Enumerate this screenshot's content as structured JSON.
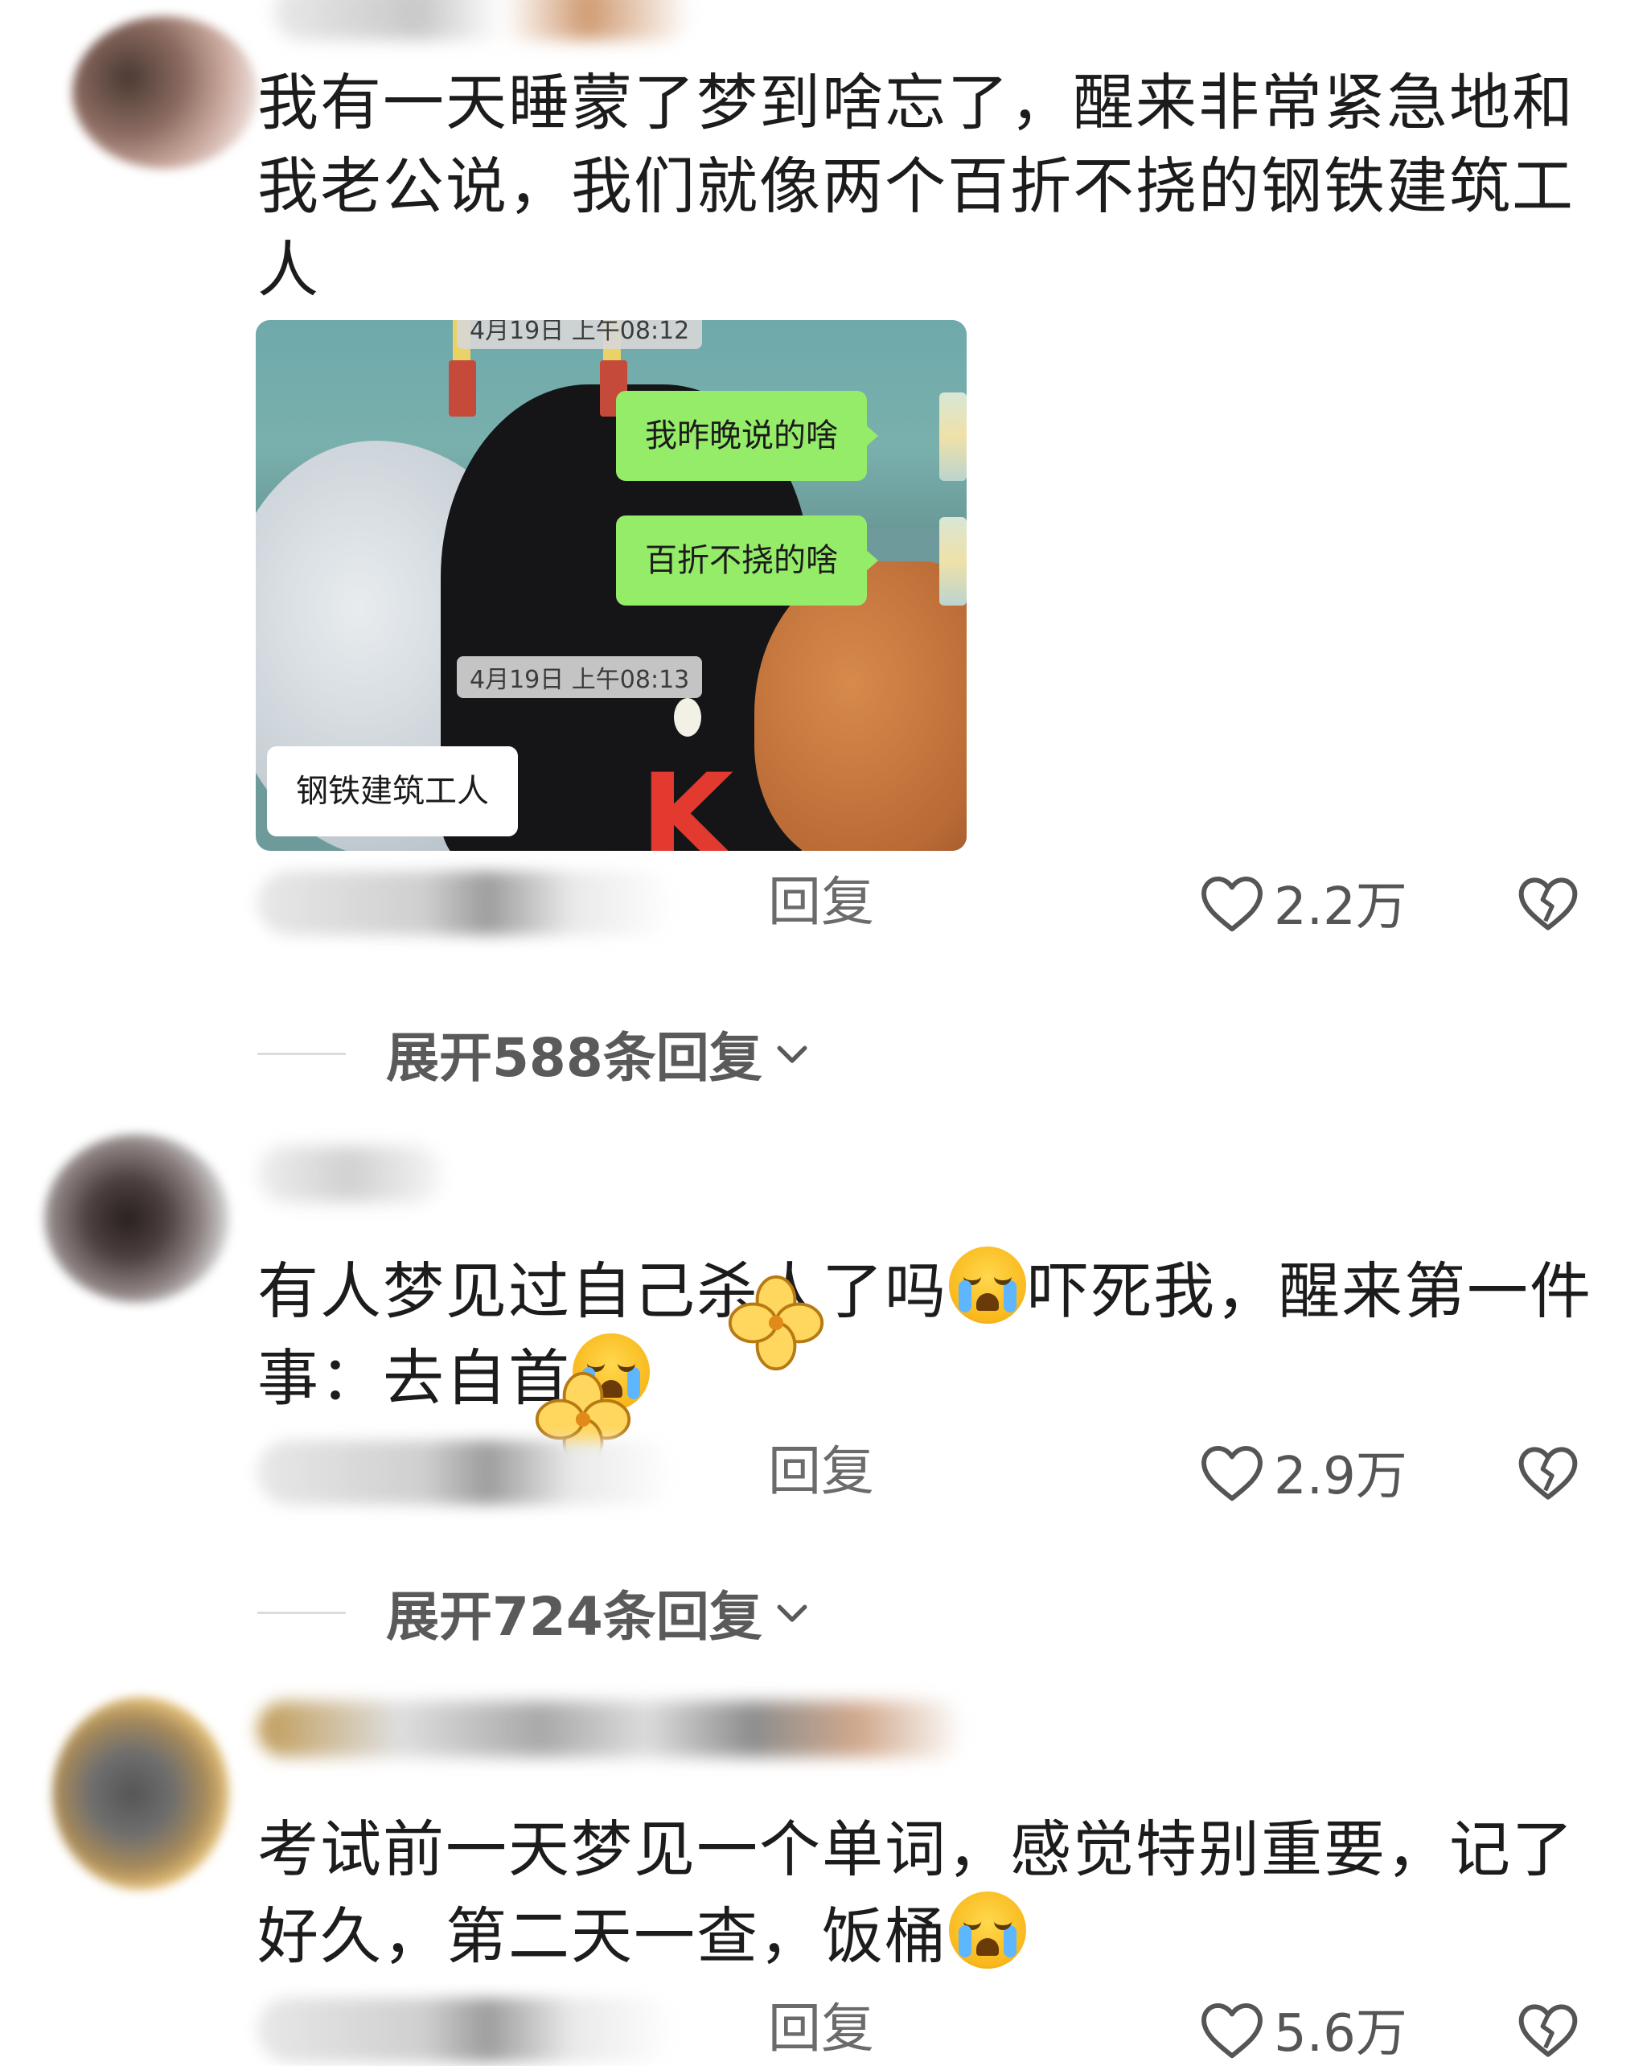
{
  "comments": [
    {
      "text": "我有一天睡蒙了梦到啥忘了，醒来非常紧急地和我老公说，我们就像两个百折不挠的钢铁建筑工人",
      "reply_label": "回复",
      "likes": "2.2万",
      "expand_label": "展开588条回复",
      "chat_image": {
        "timestamp_top": "4月19日 上午08:12",
        "bubble1": "我昨晚说的啥",
        "bubble2": "百折不挠的啥",
        "timestamp_mid": "4月19日 上午08:13",
        "reply_bubble": "钢铁建筑工人",
        "shirt_letter": "K"
      }
    },
    {
      "text_part1": "有人梦见过自己杀人了吗",
      "text_part2": "吓死我，醒来第一件事：去自首",
      "reply_label": "回复",
      "likes": "2.9万",
      "expand_label": "展开724条回复"
    },
    {
      "text": "考试前一天梦见一个单词，感觉特别重要，记了好久，第二天一查，饭桶",
      "reply_label": "回复",
      "likes": "5.6万"
    }
  ],
  "icons": {
    "like": "heart-outline-icon",
    "dislike": "broken-heart-icon",
    "expand": "chevron-down-icon",
    "emoji": "crying-face-emoji"
  },
  "colors": {
    "chat_green": "#95ec69",
    "text_primary": "#1c1c1c",
    "text_secondary": "#6b6b6b"
  }
}
